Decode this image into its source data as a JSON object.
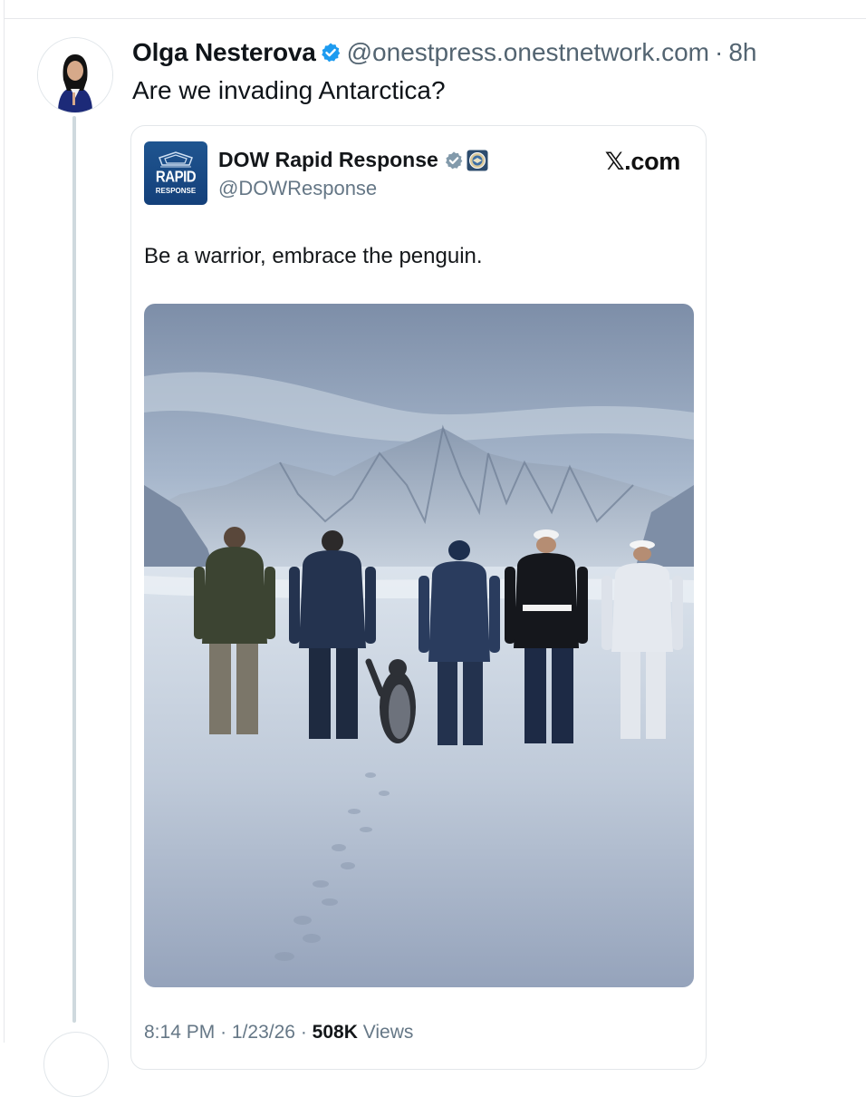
{
  "post": {
    "author_name": "Olga Nesterova",
    "author_handle": "@onestpress.onestnetwork.com",
    "separator": "·",
    "time_ago": "8h",
    "text": "Are we invading Antarctica?"
  },
  "quoted_post": {
    "author_name": "DOW Rapid Response",
    "author_handle": "@DOWResponse",
    "source": "𝕏.com",
    "text": "Be a warrior, embrace the penguin.",
    "logo_text_top": "RAPID",
    "logo_text_bottom": "RESPONSE",
    "footer": {
      "time": "8:14 PM",
      "date": "1/23/26",
      "separator": "·",
      "views_count": "508K",
      "views_label": "Views"
    }
  },
  "colors": {
    "verified_blue": "#1d9bf0",
    "muted_text": "#536471",
    "thread_line": "#cfd9de",
    "logo_blue": "#1a4b86"
  },
  "icons": {
    "verified": "verified-badge-icon",
    "gray_verified": "gray-verified-badge-icon",
    "seal": "dod-seal-icon"
  }
}
